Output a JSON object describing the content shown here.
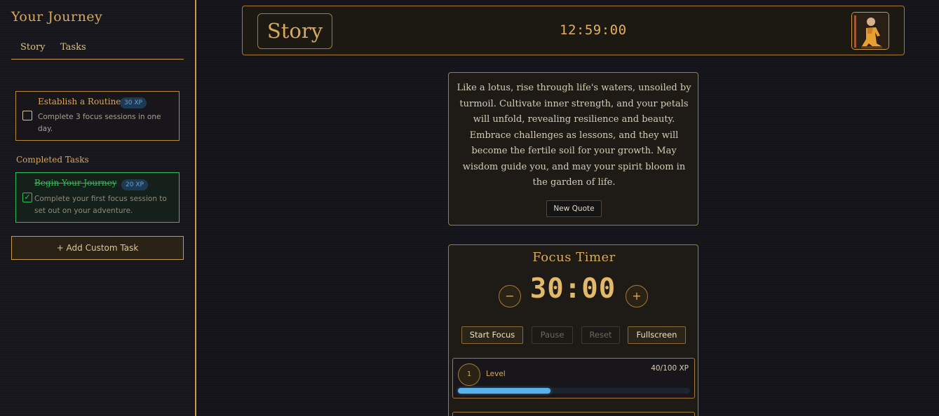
{
  "sidebar": {
    "title": "Your Journey",
    "tabs": [
      {
        "label": "Story"
      },
      {
        "label": "Tasks"
      }
    ],
    "active_tasks": [
      {
        "title": "Establish a Routine",
        "xp": "30 XP",
        "description": "Complete 3 focus sessions in one day.",
        "checked": false
      }
    ],
    "completed_heading": "Completed Tasks",
    "completed_tasks": [
      {
        "title": "Begin Your Journey",
        "xp": "20 XP",
        "description": "Complete your first focus session to set out on your adventure.",
        "checked": true,
        "check_glyph": "✓"
      }
    ],
    "add_task_label": "+ Add Custom Task"
  },
  "header": {
    "title": "Story",
    "clock": "12:59:00",
    "avatar_icon": "monk-avatar-icon"
  },
  "quote": {
    "text": "Like a lotus, rise through life's waters, unsoiled by turmoil. Cultivate inner strength, and your petals will unfold, revealing resilience and beauty. Embrace challenges as lessons, and they will become the fertile soil for your growth. May wisdom guide you, and may your spirit bloom in the garden of life.",
    "button_label": "New Quote"
  },
  "timer": {
    "title": "Focus Timer",
    "display": "30:00",
    "decrease_label": "−",
    "increase_label": "+",
    "buttons": {
      "start": "Start Focus",
      "pause": "Pause",
      "reset": "Reset",
      "fullscreen": "Fullscreen"
    },
    "level": {
      "number": "1",
      "label": "Level",
      "xp_text": "40/100 XP",
      "progress_fraction": 0.4
    }
  },
  "colors": {
    "accent": "#d9a95a",
    "border": "#a67a36",
    "success": "#2fbf5a",
    "xp_bar": "#5ab4ec",
    "background": "#14141a"
  }
}
